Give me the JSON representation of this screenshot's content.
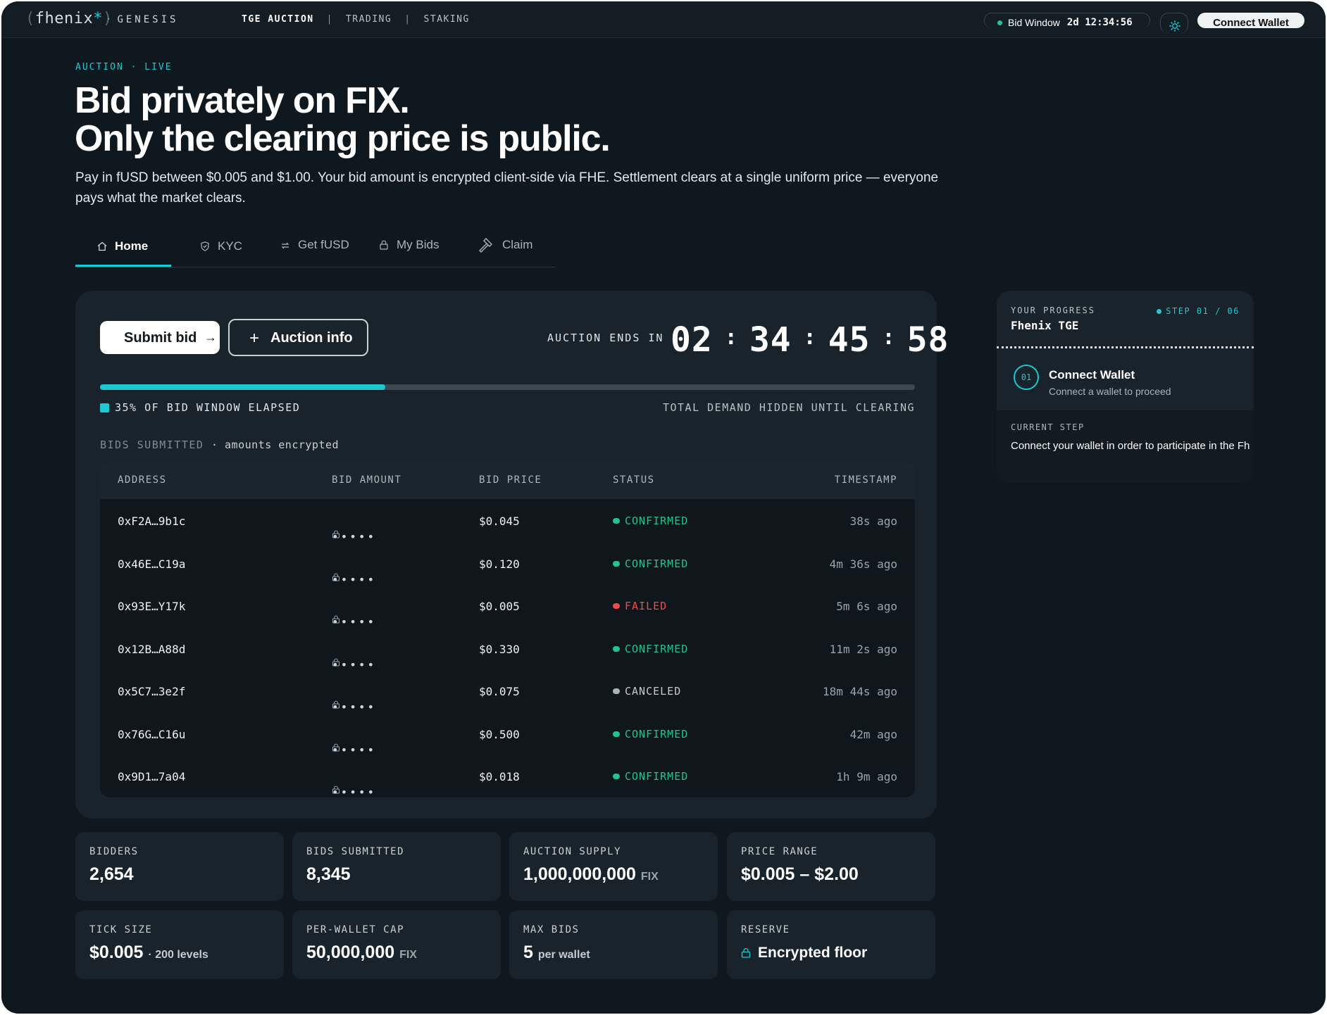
{
  "topbar": {
    "logo": "fhenix",
    "brand": "GENESIS",
    "nav": [
      "TGE AUCTION",
      "TRADING",
      "STAKING"
    ],
    "nav_sep": "|",
    "bid_window_label": "Bid Window",
    "bid_window_time": "2d 12:34:56",
    "connect_label": "Connect Wallet"
  },
  "hero": {
    "eyebrow": "AUCTION · LIVE",
    "title_line1": "Bid privately on FIX.",
    "title_line2": "Only the clearing price is public.",
    "lead": "Pay in fUSD between $0.005 and $1.00. Your bid amount is encrypted client-side via FHE. Settlement clears at a single uniform price — everyone pays what the market clears."
  },
  "tabs": [
    {
      "label": "Home",
      "icon": "home-icon",
      "active": true
    },
    {
      "label": "KYC",
      "icon": "shield-icon"
    },
    {
      "label": "Get fUSD",
      "icon": "swap-icon"
    },
    {
      "label": "My Bids",
      "icon": "lock-icon"
    },
    {
      "label": "Claim",
      "icon": "gavel-icon"
    }
  ],
  "actions": {
    "submit_label": "Submit bid",
    "info_label": "Auction info"
  },
  "countdown": {
    "label": "AUCTION ENDS IN",
    "values": [
      "02",
      "34",
      "45",
      "58"
    ]
  },
  "progress": {
    "fraction": 0.35,
    "left_label": "35% OF BID WINDOW ELAPSED",
    "right_label": "TOTAL DEMAND HIDDEN UNTIL CLEARING"
  },
  "bids": {
    "label": "BIDS SUBMITTED",
    "sublabel": "· amounts encrypted",
    "headers": [
      "ADDRESS",
      "BID AMOUNT",
      "BID PRICE",
      "STATUS",
      "TIMESTAMP"
    ],
    "masked": "•••••",
    "rows": [
      {
        "address": "0xF2A…9b1c",
        "price": "$0.045",
        "status": "CONFIRMED",
        "kind": "ok",
        "time": "38s ago"
      },
      {
        "address": "0x46E…C19a",
        "price": "$0.120",
        "status": "CONFIRMED",
        "kind": "ok",
        "time": "4m 36s ago"
      },
      {
        "address": "0x93E…Y17k",
        "price": "$0.005",
        "status": "FAILED",
        "kind": "fail",
        "time": "5m 6s ago"
      },
      {
        "address": "0x12B…A88d",
        "price": "$0.330",
        "status": "CONFIRMED",
        "kind": "ok",
        "time": "11m 2s ago"
      },
      {
        "address": "0x5C7…3e2f",
        "price": "$0.075",
        "status": "CANCELED",
        "kind": "canc",
        "time": "18m 44s ago"
      },
      {
        "address": "0x76G…C16u",
        "price": "$0.500",
        "status": "CONFIRMED",
        "kind": "ok",
        "time": "42m ago"
      },
      {
        "address": "0x9D1…7a04",
        "price": "$0.018",
        "status": "CONFIRMED",
        "kind": "ok",
        "time": "1h 9m ago"
      }
    ]
  },
  "stats": [
    {
      "label": "BIDDERS",
      "value": "2,654",
      "unit": ""
    },
    {
      "label": "BIDS SUBMITTED",
      "value": "8,345",
      "unit": ""
    },
    {
      "label": "AUCTION SUPPLY",
      "value": "1,000,000,000",
      "unit": "FIX"
    },
    {
      "label": "PRICE RANGE",
      "value": "$0.005 – $2.00",
      "unit": ""
    },
    {
      "label": "TICK SIZE",
      "value": "$0.005",
      "unit": "· 200 levels"
    },
    {
      "label": "PER-WALLET CAP",
      "value": "50,000,000",
      "unit": "FIX"
    },
    {
      "label": "MAX BIDS",
      "value": "5",
      "unit": "per wallet"
    },
    {
      "label": "RESERVE",
      "value": "Encrypted floor",
      "unit": ""
    }
  ],
  "progress_panel": {
    "label": "YOUR PROGRESS",
    "title": "Fhenix TGE",
    "step": "STEP 01 / 06",
    "step_number": "01",
    "step_title": "Connect Wallet",
    "step_sub": "Connect a wallet to proceed",
    "current_label": "CURRENT STEP",
    "current_text": "Connect your wallet in order to participate in the Fh"
  },
  "colors": {
    "accent": "#1ec8d3",
    "confirmed": "#22c38e",
    "failed": "#ef4b4b",
    "background": "#0f181e"
  }
}
